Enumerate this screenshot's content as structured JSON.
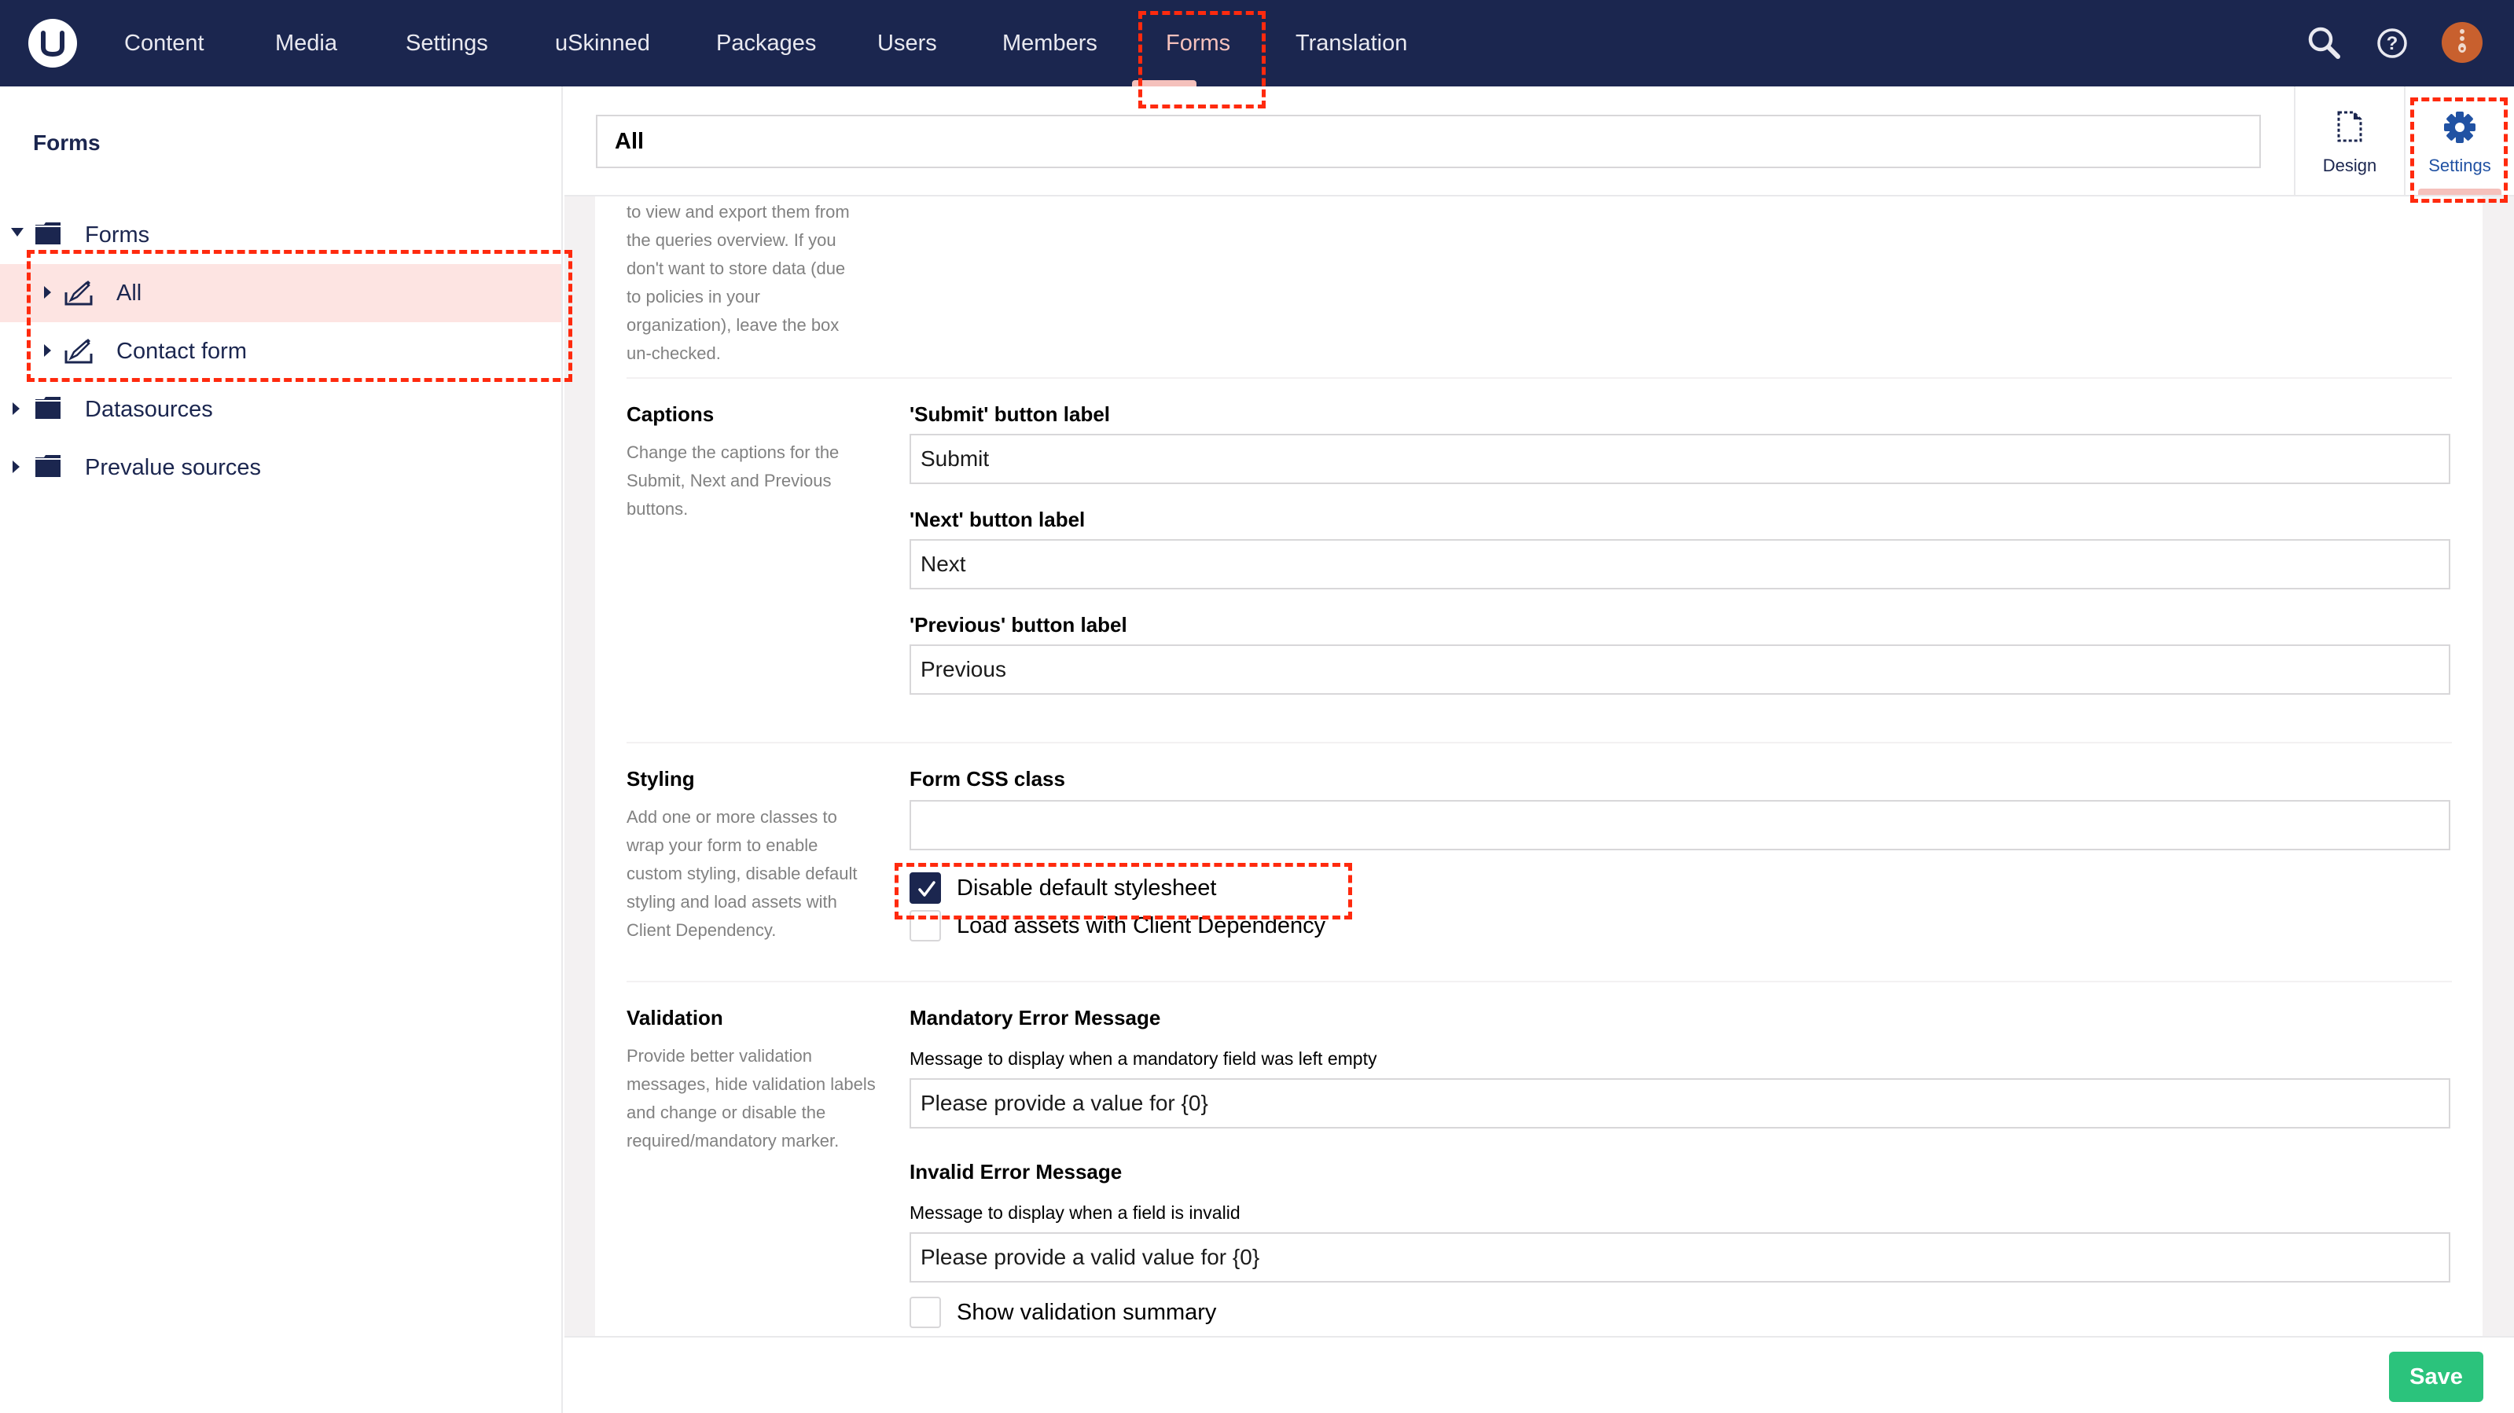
{
  "topnav": {
    "items": [
      {
        "label": "Content",
        "active": false
      },
      {
        "label": "Media",
        "active": false
      },
      {
        "label": "Settings",
        "active": false
      },
      {
        "label": "uSkinned",
        "active": false
      },
      {
        "label": "Packages",
        "active": false
      },
      {
        "label": "Users",
        "active": false
      },
      {
        "label": "Members",
        "active": false
      },
      {
        "label": "Forms",
        "active": true
      },
      {
        "label": "Translation",
        "active": false
      }
    ],
    "icons": [
      "search-icon",
      "help-icon",
      "user-avatar"
    ]
  },
  "sidebar": {
    "title": "Forms",
    "tree": [
      {
        "label": "Forms",
        "icon": "folder-icon",
        "expanded": true,
        "level": 0
      },
      {
        "label": "All",
        "icon": "form-icon",
        "expanded": false,
        "level": 1,
        "selected": true
      },
      {
        "label": "Contact form",
        "icon": "form-icon",
        "expanded": false,
        "level": 1
      },
      {
        "label": "Datasources",
        "icon": "folder-icon",
        "expanded": false,
        "level": 0
      },
      {
        "label": "Prevalue sources",
        "icon": "folder-icon",
        "expanded": false,
        "level": 0
      }
    ]
  },
  "editor": {
    "name_value": "All",
    "tabs": [
      {
        "label": "Design",
        "icon": "document-icon",
        "active": false
      },
      {
        "label": "Settings",
        "icon": "gear-icon",
        "active": true
      }
    ]
  },
  "groups": {
    "storage": {
      "desc_lines": [
        "to view and export them from",
        "the queries overview. If you",
        "don't want to store data (due",
        "to policies in your",
        "organization), leave the box",
        "un-checked."
      ]
    },
    "captions": {
      "title": "Captions",
      "desc": "Change the captions for the Submit, Next and Previous buttons.",
      "fields": [
        {
          "label": "'Submit' button label",
          "value": "Submit"
        },
        {
          "label": "'Next' button label",
          "value": "Next"
        },
        {
          "label": "'Previous' button label",
          "value": "Previous"
        }
      ]
    },
    "styling": {
      "title": "Styling",
      "desc": "Add one or more classes to wrap your form to enable custom styling, disable default styling and load assets with Client Dependency.",
      "css_class_label": "Form CSS class",
      "css_class_value": "",
      "checkboxes": [
        {
          "label": "Disable default stylesheet",
          "checked": true
        },
        {
          "label": "Load assets with Client Dependency",
          "checked": false
        }
      ]
    },
    "validation": {
      "title": "Validation",
      "desc": "Provide better validation messages, hide validation labels and change or disable the required/mandatory marker.",
      "mandatory_label": "Mandatory Error Message",
      "mandatory_sub": "Message to display when a mandatory field was left empty",
      "mandatory_value": "Please provide a value for {0}",
      "invalid_label": "Invalid Error Message",
      "invalid_sub": "Message to display when a field is invalid",
      "invalid_value": "Please provide a valid value for {0}",
      "summary_checkbox": {
        "label": "Show validation summary",
        "checked": false
      }
    }
  },
  "footer": {
    "save_label": "Save"
  },
  "colors": {
    "nav_bg": "#1b264f",
    "accent_pink": "#f5c1bc",
    "selected_row": "#fde4e2",
    "save_green": "#2bc37c",
    "active_tab_blue": "#2152a3",
    "annotation_red": "#ff2a0e"
  }
}
